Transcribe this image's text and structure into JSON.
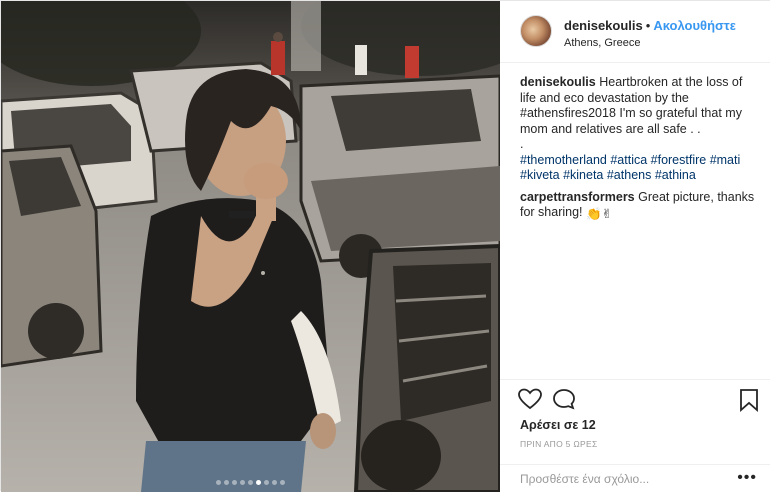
{
  "post": {
    "username": "denisekoulis",
    "separator": "•",
    "follow_label": "Ακολουθήστε",
    "location": "Athens, Greece",
    "caption": {
      "user": "denisekoulis",
      "text": "Heartbroken at the loss of life and eco devastation by the #athensfires2018 I'm so grateful that my mom and relatives are all safe . .",
      "dot": ".",
      "hashtags": "#themotherland #attica #forestfire #mati #kiveta #kineta #athens #athina"
    },
    "comment": {
      "user": "carpettransformers",
      "text": "Great picture, thanks for sharing!",
      "emoji": "👏✌"
    },
    "likes": "Αρέσει σε 12",
    "time_ago": "ΠΡΙΝ ΑΠΟ 5 ΩΡΕΣ",
    "add_comment_placeholder": "Προσθέστε ένα σχόλιο...",
    "more": "•••"
  },
  "carousel": {
    "count": 9,
    "active_index": 5
  },
  "icons": {
    "like": "heart-icon",
    "comment": "comment-icon",
    "save": "bookmark-icon"
  },
  "colors": {
    "follow": "#3897f0",
    "hashtag": "#003569",
    "muted": "#999999"
  }
}
